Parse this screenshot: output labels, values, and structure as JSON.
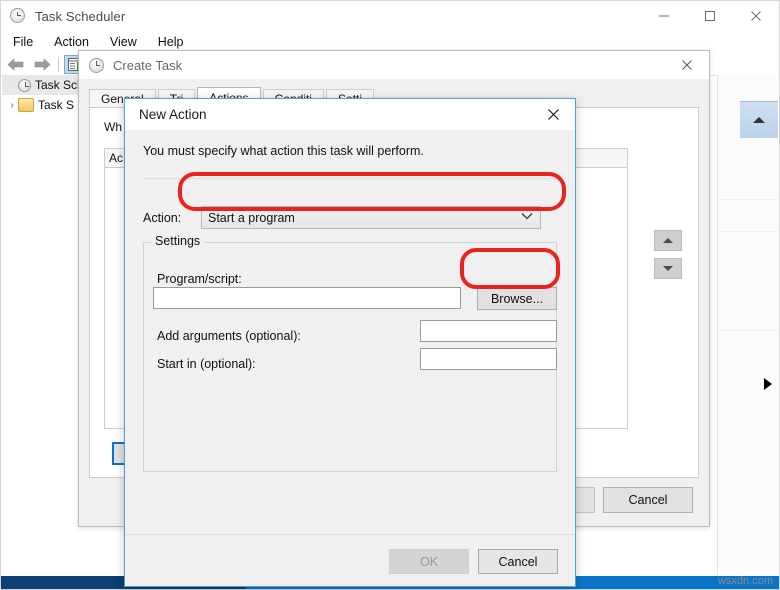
{
  "main_window": {
    "title": "Task Scheduler",
    "title_icon": "clock-icon",
    "menus": [
      "File",
      "Action",
      "View",
      "Help"
    ],
    "toolbar": {
      "back_icon": "back-arrow-icon",
      "forward_icon": "forward-arrow-icon",
      "view_icon": "show-hide-console-tree-icon"
    },
    "tree": [
      {
        "label": "Task Sche",
        "icon": "clock-icon",
        "expander": "",
        "selected": true
      },
      {
        "label": "Task S",
        "icon": "folder-icon",
        "expander": "›",
        "selected": false
      }
    ],
    "window_controls": {
      "minimize": "minimize-icon",
      "maximize": "maximize-icon",
      "close": "close-icon"
    },
    "watermark": "wsxdn.com"
  },
  "create_task": {
    "title": "Create Task",
    "title_icon": "clock-icon",
    "close_icon": "close-icon",
    "tabs": [
      {
        "label": "General",
        "active": false
      },
      {
        "label": "Tri",
        "active": false
      },
      {
        "label": "Actions",
        "active": true
      },
      {
        "label": "Conditi",
        "active": false
      },
      {
        "label": "Setti",
        "active": false
      }
    ],
    "panel_text": "Wh",
    "list_header": "Ac",
    "buttons": {
      "new": "",
      "cancel": "Cancel",
      "ok": "",
      "move_up_icon": "arrow-up-icon",
      "move_down_icon": "arrow-down-icon"
    }
  },
  "new_action": {
    "title": "New Action",
    "close_icon": "close-icon",
    "instruction": "You must specify what action this task will perform.",
    "action_label": "Action:",
    "action_value": "Start a program",
    "action_caret_icon": "chevron-down-icon",
    "settings_group_title": "Settings",
    "program_label": "Program/script:",
    "program_value": "",
    "browse_label": "Browse...",
    "arguments_label": "Add arguments (optional):",
    "arguments_value": "",
    "startin_label": "Start in (optional):",
    "startin_value": "",
    "ok_label": "OK",
    "cancel_label": "Cancel"
  },
  "annotations": {
    "color": "#e8241f",
    "items": [
      {
        "name": "action-dropdown-highlight",
        "target": "Action combo box"
      },
      {
        "name": "browse-button-highlight",
        "target": "Browse... button"
      }
    ]
  }
}
